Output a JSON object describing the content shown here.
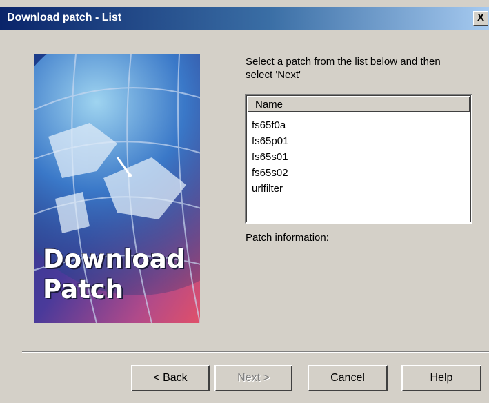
{
  "window": {
    "title": "Download patch - List",
    "close_label": "X"
  },
  "banner": {
    "line1": "Download",
    "line2": "Patch"
  },
  "instructions": "Select a patch from the list below and then select 'Next'",
  "list": {
    "column_header": "Name",
    "items": [
      "fs65f0a",
      "fs65p01",
      "fs65s01",
      "fs65s02",
      "urlfilter"
    ]
  },
  "patch_info_label": "Patch information:",
  "buttons": {
    "back": "< Back",
    "next": "Next >",
    "cancel": "Cancel",
    "help": "Help"
  }
}
